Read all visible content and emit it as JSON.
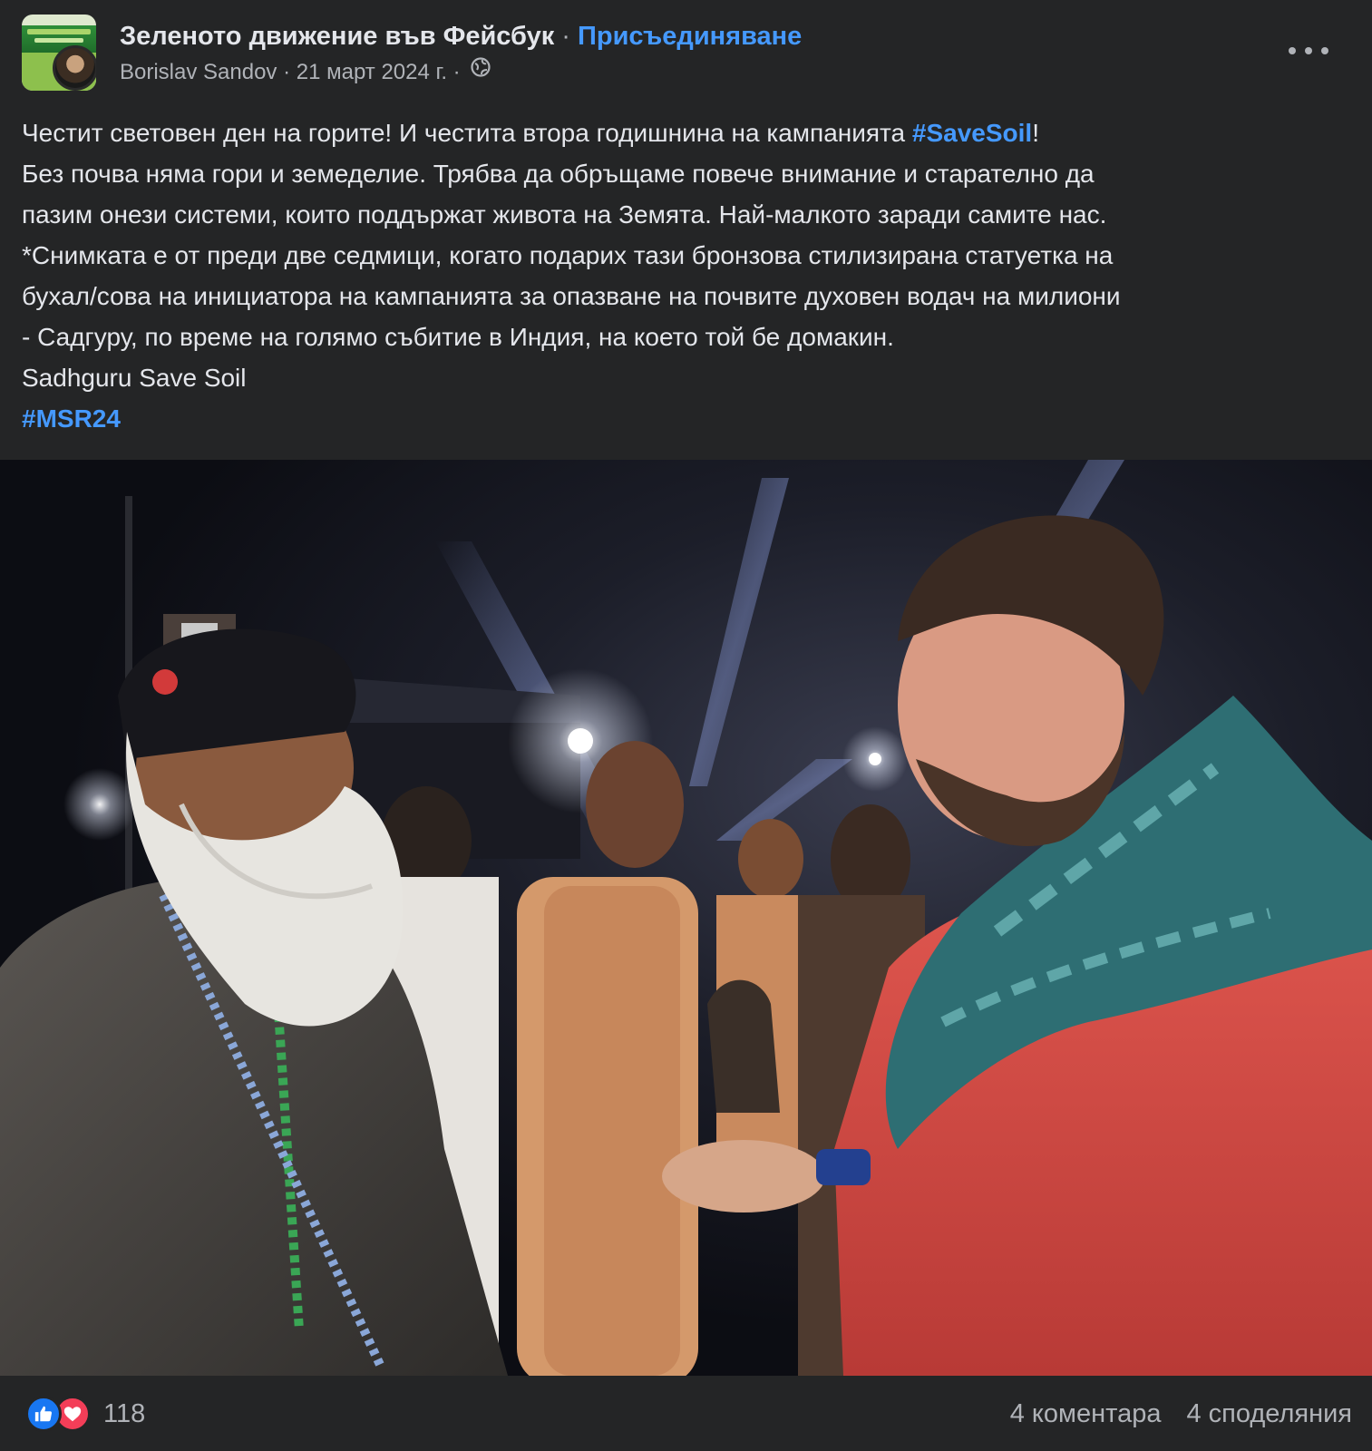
{
  "header": {
    "group_name": "Зеленото движение във Фейсбук",
    "separator": " · ",
    "join_label": "Присъединяване",
    "author": "Borislav Sandov",
    "date": "21 март 2024 г.",
    "meta_separator": " · ",
    "privacy_icon": "globe-icon",
    "more_icon": "more-options-icon"
  },
  "post": {
    "line1_before": "Честит световен ден на горите! И честита втора годишнина на кампанията ",
    "hashtag_savesoil": "#SaveSoil",
    "line1_after": "!",
    "line2": "Без почва няма гори и земеделие. Трябва да обръщаме повече внимание и старателно да",
    "line3": "пазим онези системи, които поддържат живота на Земята. Най-малкото заради самите нас.",
    "line4": "*Снимката е от преди две седмици, когато подарих тази бронзова стилизирана статуетка на",
    "line5": "бухал/сова на инициатора на кампанията за опазване на почвите духовен водач на милиони",
    "line6": "- Садгуру, по време на голямо събитие в Индия, на което той бе домакин.",
    "line7": "Sadhguru Save Soil",
    "hashtag_msr": "#MSR24"
  },
  "footer": {
    "reaction_icons": [
      "like-icon",
      "love-icon"
    ],
    "reaction_count": "118",
    "comments": "4 коментара",
    "shares": "4 споделяния"
  },
  "colors": {
    "background": "#242526",
    "text": "#e4e6eb",
    "secondary_text": "#b0b3b8",
    "link": "#4599ff",
    "like": "#1877f2",
    "love": "#f33e58"
  }
}
